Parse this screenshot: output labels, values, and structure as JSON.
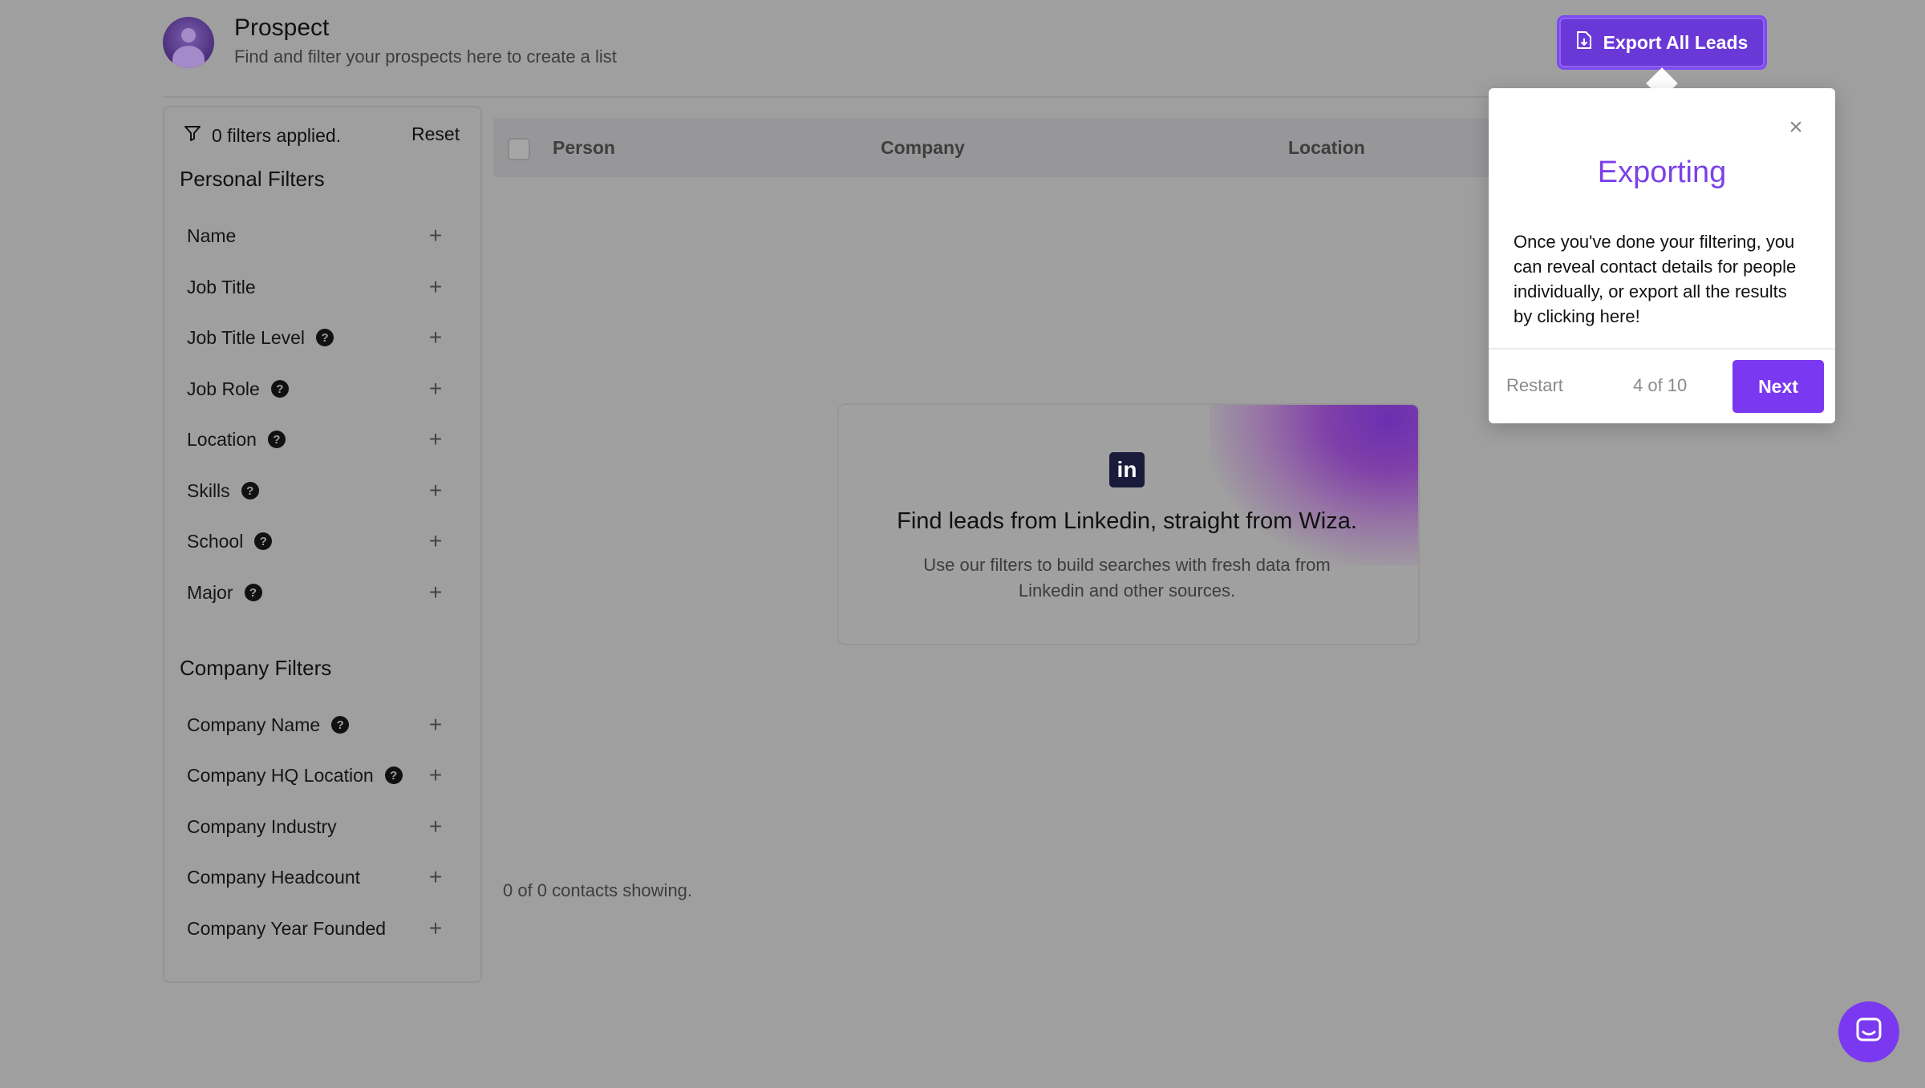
{
  "header": {
    "title": "Prospect",
    "subtitle": "Find and filter your prospects here to create a list",
    "export_label": "Export All Leads"
  },
  "sidebar": {
    "filters_applied": "0 filters applied.",
    "reset_label": "Reset",
    "personal_title": "Personal Filters",
    "personal_filters": [
      {
        "label": "Name",
        "help": false
      },
      {
        "label": "Job Title",
        "help": false
      },
      {
        "label": "Job Title Level",
        "help": true
      },
      {
        "label": "Job Role",
        "help": true
      },
      {
        "label": "Location",
        "help": true
      },
      {
        "label": "Skills",
        "help": true
      },
      {
        "label": "School",
        "help": true
      },
      {
        "label": "Major",
        "help": true
      }
    ],
    "company_title": "Company Filters",
    "company_filters": [
      {
        "label": "Company Name",
        "help": true
      },
      {
        "label": "Company HQ Location",
        "help": true
      },
      {
        "label": "Company Industry",
        "help": false
      },
      {
        "label": "Company Headcount",
        "help": false
      },
      {
        "label": "Company Year Founded",
        "help": false
      }
    ]
  },
  "table": {
    "columns": [
      "Person",
      "Company",
      "Location"
    ],
    "empty_title": "Find leads from Linkedin, straight from Wiza.",
    "empty_text": "Use our filters to build searches with fresh data from Linkedin and other sources.",
    "contacts_count": "0 of 0 contacts showing."
  },
  "tooltip": {
    "title": "Exporting",
    "body": "Once you've done your filtering, you can reveal contact details for people individually, or export all the results by clicking here!",
    "restart_label": "Restart",
    "step": "4 of 10",
    "next_label": "Next"
  },
  "icons": {
    "help": "?",
    "plus": "+",
    "close": "×",
    "linkedin": "in"
  },
  "colors": {
    "accent": "#7a38f0",
    "tooltip_title": "#7a42e8",
    "overlay": "#9f9f9f"
  }
}
